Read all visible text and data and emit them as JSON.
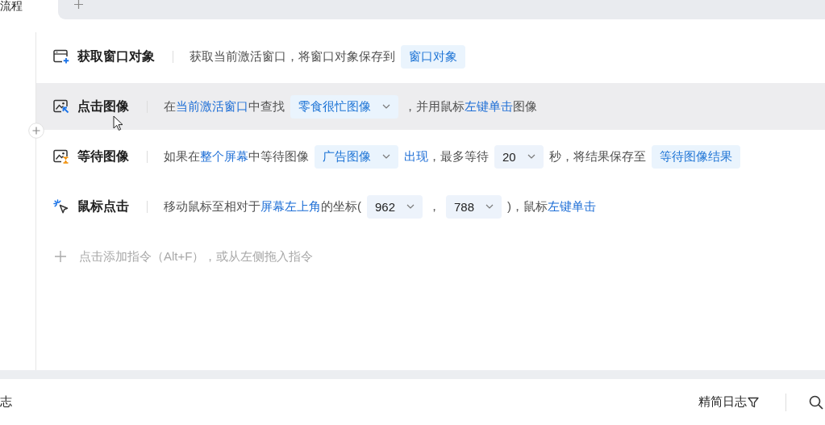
{
  "tabs": [
    {
      "label": "流程",
      "selected": true
    }
  ],
  "commands": [
    {
      "kind": "window",
      "title": "获取窗口对象",
      "hovered": false,
      "parts": [
        {
          "kind": "text",
          "text": "获取当前激活窗口，将窗口对象保存到"
        },
        {
          "kind": "tag",
          "text": "窗口对象"
        }
      ]
    },
    {
      "kind": "click",
      "title": "点击图像",
      "hovered": true,
      "parts": [
        {
          "kind": "text",
          "text": "在"
        },
        {
          "kind": "link",
          "text": "当前激活窗口"
        },
        {
          "kind": "text",
          "text": "中查找"
        },
        {
          "kind": "select",
          "text": "零食很忙图像"
        },
        {
          "kind": "text",
          "text": "，并用鼠标"
        },
        {
          "kind": "link",
          "text": "左键单击"
        },
        {
          "kind": "text",
          "text": "图像"
        }
      ]
    },
    {
      "kind": "wait",
      "title": "等待图像",
      "hovered": false,
      "parts": [
        {
          "kind": "text",
          "text": "如果在"
        },
        {
          "kind": "link",
          "text": "整个屏幕"
        },
        {
          "kind": "text",
          "text": "中等待图像"
        },
        {
          "kind": "select",
          "text": "广告图像"
        },
        {
          "kind": "link",
          "text": "出现"
        },
        {
          "kind": "text",
          "text": "，最多等待"
        },
        {
          "kind": "number",
          "text": "20"
        },
        {
          "kind": "text",
          "text": "秒，将结果保存至"
        },
        {
          "kind": "tag",
          "text": "等待图像结果"
        }
      ]
    },
    {
      "kind": "pointer",
      "title": "鼠标点击",
      "hovered": false,
      "parts": [
        {
          "kind": "text",
          "text": "移动鼠标至相对于"
        },
        {
          "kind": "link",
          "text": "屏幕左上角"
        },
        {
          "kind": "text",
          "text": "的坐标("
        },
        {
          "kind": "number",
          "text": "962"
        },
        {
          "kind": "text",
          "text": "，"
        },
        {
          "kind": "number",
          "text": "788"
        },
        {
          "kind": "text",
          "text": ")，鼠标"
        },
        {
          "kind": "link",
          "text": "左键单击"
        }
      ]
    }
  ],
  "add_hint": "点击添加指令（Alt+F），或从左侧拖入指令",
  "log_panel": {
    "title": "志",
    "filter": "精简日志"
  }
}
